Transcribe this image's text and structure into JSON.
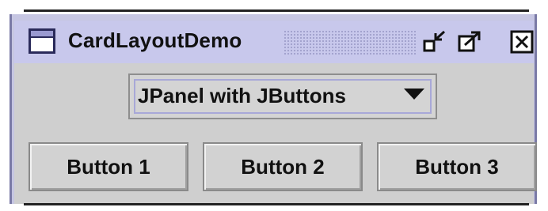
{
  "window": {
    "title": "CardLayoutDemo",
    "controls": {
      "iconify_icon": "iconify-icon",
      "maximize_icon": "maximize-icon",
      "close_icon": "close-icon"
    }
  },
  "combo": {
    "selected": "JPanel with JButtons",
    "arrow_icon": "triangle-down-icon"
  },
  "buttons": [
    {
      "label": "Button 1"
    },
    {
      "label": "Button 2"
    },
    {
      "label": "Button 3"
    }
  ],
  "colors": {
    "titlebar": "#c8c8ec",
    "content_bg": "#cfcfcf",
    "frame_border": "#7a7aa6"
  }
}
